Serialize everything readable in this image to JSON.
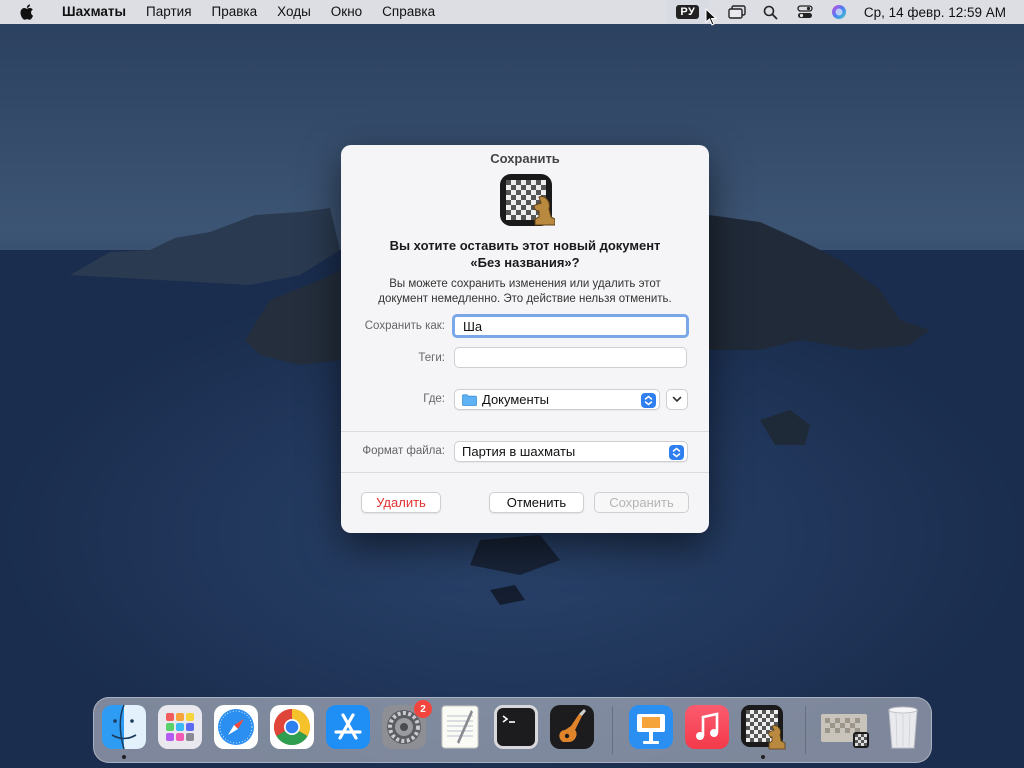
{
  "menubar": {
    "app_name": "Шахматы",
    "items": [
      "Партия",
      "Правка",
      "Ходы",
      "Окно",
      "Справка"
    ],
    "input_source": "РУ",
    "clock": "Ср, 14 февр.  12:59 AM"
  },
  "dialog": {
    "title": "Сохранить",
    "heading_line1": "Вы хотите оставить этот новый документ",
    "heading_line2": "«Без названия»?",
    "info_line1": "Вы можете сохранить изменения или удалить этот",
    "info_line2": "документ немедленно. Это действие нельзя отменить.",
    "save_as_label": "Сохранить как:",
    "save_as_value": "Ша",
    "tags_label": "Теги:",
    "tags_value": "",
    "where_label": "Где:",
    "where_value": "Документы",
    "format_label": "Формат файла:",
    "format_value": "Партия в шахматы",
    "delete_button": "Удалить",
    "cancel_button": "Отменить",
    "save_button": "Сохранить"
  },
  "dock": {
    "apps": [
      "finder-icon",
      "launchpad-icon",
      "safari-icon",
      "chrome-icon",
      "app-store-icon",
      "system-preferences-icon",
      "textedit-icon",
      "terminal-icon",
      "garageband-icon",
      "keynote-icon",
      "music-icon",
      "chess-icon"
    ],
    "system_preferences_badge": "2"
  },
  "colors": {
    "accent": "#2f7ff0",
    "danger": "#e0312f",
    "focus_ring": "#7aa7e8"
  }
}
